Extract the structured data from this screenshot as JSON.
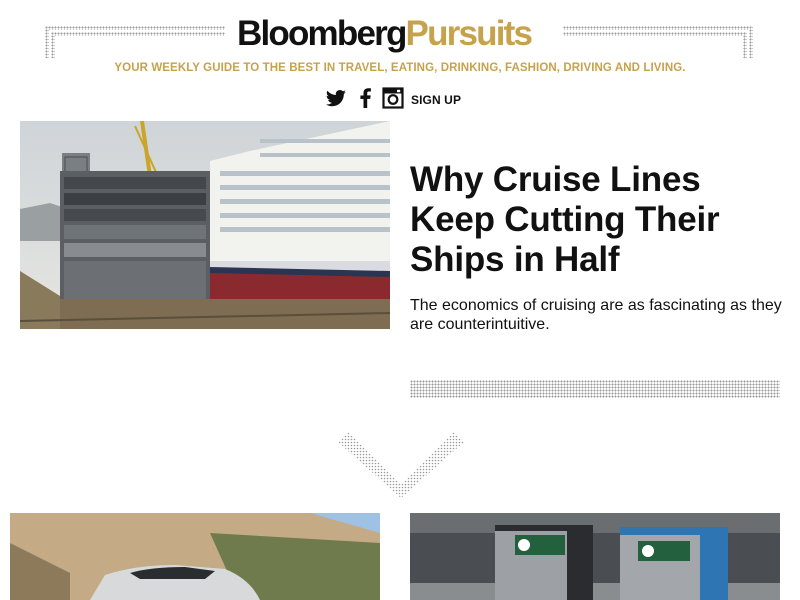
{
  "header": {
    "logo_part1": "Bloomberg",
    "logo_part2": "Pursuits",
    "tagline": "YOUR WEEKLY GUIDE TO THE BEST IN TRAVEL, EATING, DRINKING, FASHION, DRIVING AND LIVING.",
    "social": [
      {
        "icon": "twitter-icon"
      },
      {
        "icon": "facebook-icon"
      },
      {
        "icon": "instagram-icon"
      }
    ],
    "signup_label": "SIGN UP"
  },
  "hero": {
    "image": "cruise-ship-cut-in-half-photo",
    "title": "Why Cruise Lines Keep Cutting Their Ships in Half",
    "description": "The economics of cruising are as fascinating as they are counterintuitive."
  },
  "scroll_indicator": {
    "icon": "chevron-down-icon"
  },
  "cards": [
    {
      "image": "car-on-mountain-road-photo"
    },
    {
      "image": "recycling-bins-photo"
    }
  ],
  "colors": {
    "brand_gold": "#c7a24c",
    "text": "#111111"
  }
}
